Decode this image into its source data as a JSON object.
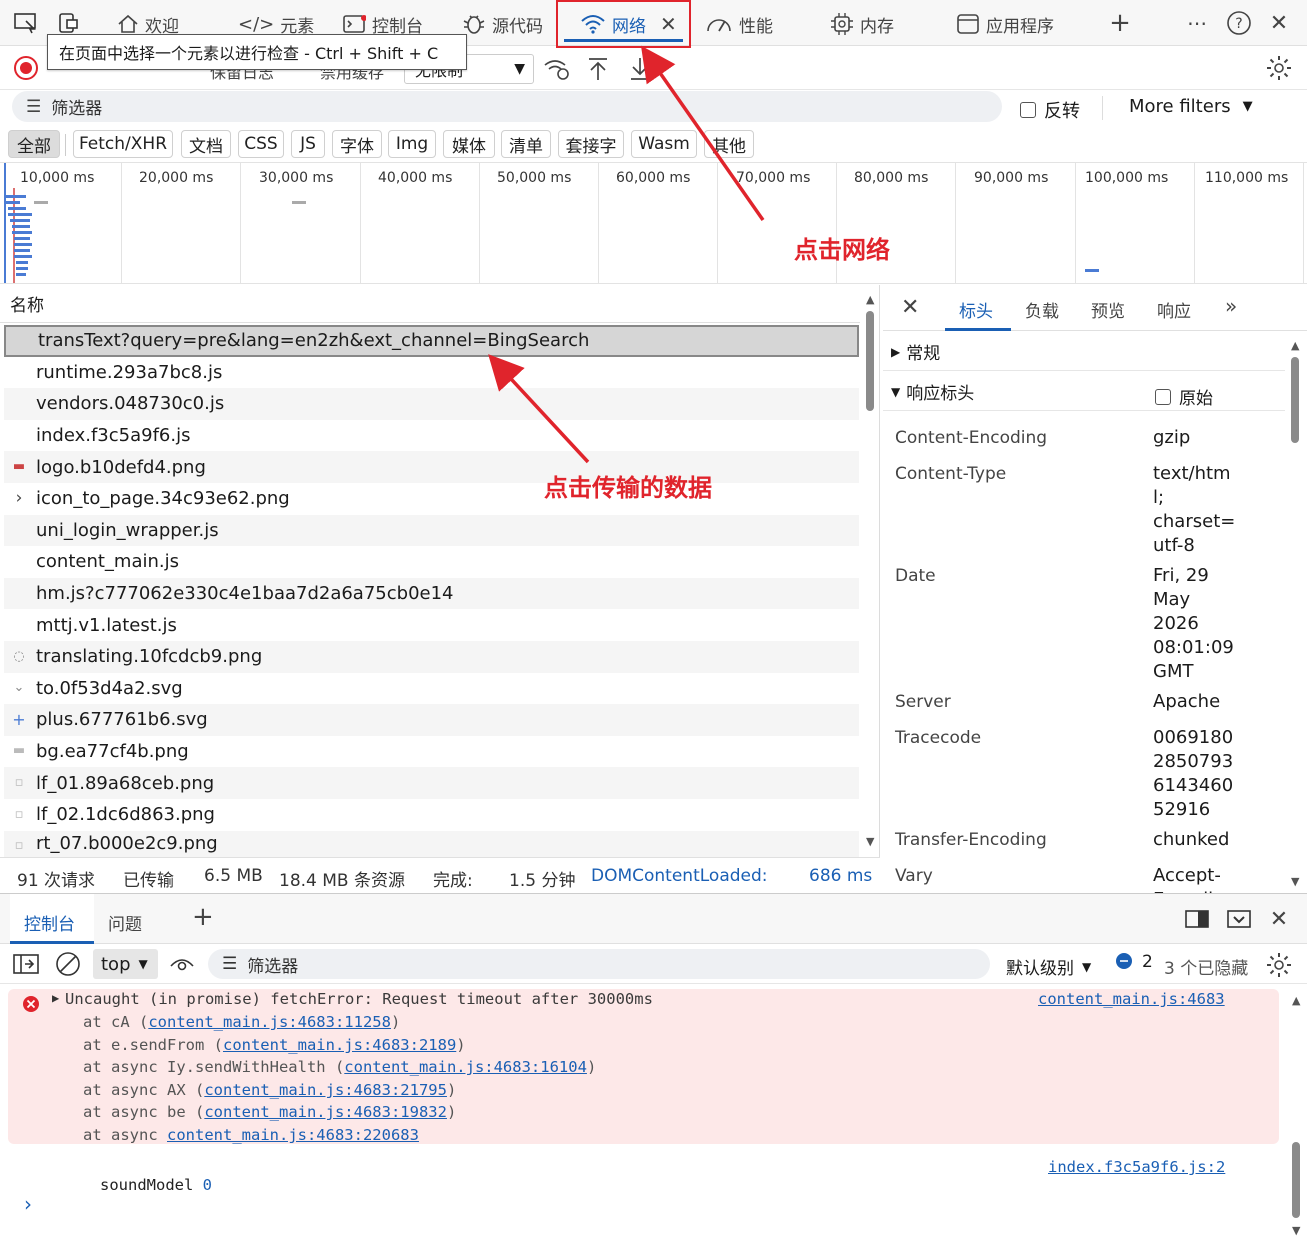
{
  "top_tabs": {
    "welcome": "欢迎",
    "elements": "元素",
    "console": "控制台",
    "sources": "源代码",
    "network": "网络",
    "performance": "性能",
    "memory": "内存",
    "application": "应用程序"
  },
  "tooltip": "在页面中选择一个元素以进行检查 - Ctrl + Shift + C",
  "toolbar": {
    "preserve_log": "保留日志",
    "disable_cache": "禁用缓存",
    "throttle": "无限制"
  },
  "filter": {
    "placeholder": "筛选器",
    "invert": "反转",
    "more_filters": "More filters"
  },
  "type_chips": [
    "全部",
    "Fetch/XHR",
    "文档",
    "CSS",
    "JS",
    "字体",
    "Img",
    "媒体",
    "清单",
    "套接字",
    "Wasm",
    "其他"
  ],
  "timeline_ticks": [
    "10,000 ms",
    "20,000 ms",
    "30,000 ms",
    "40,000 ms",
    "50,000 ms",
    "60,000 ms",
    "70,000 ms",
    "80,000 ms",
    "90,000 ms",
    "100,000 ms",
    "110,000 ms"
  ],
  "request_list": {
    "header": "名称",
    "rows": [
      "transText?query=pre&lang=en2zh&ext_channel=BingSearch",
      "runtime.293a7bc8.js",
      "vendors.048730c0.js",
      "index.f3c5a9f6.js",
      "logo.b10defd4.png",
      "icon_to_page.34c93e62.png",
      "uni_login_wrapper.js",
      "content_main.js",
      "hm.js?c777062e330c4e1baa7d2a6a75cb0e14",
      "mttj.v1.latest.js",
      "translating.10fcdcb9.png",
      "to.0f53d4a2.svg",
      "plus.677761b6.svg",
      "bg.ea77cf4b.png",
      "lf_01.89a68ceb.png",
      "lf_02.1dc6d863.png",
      "rt_07.b000e2c9.png"
    ]
  },
  "status_bar": {
    "requests": "91 次请求",
    "transferred_label": "已传输",
    "transferred": "6.5 MB",
    "resources": "18.4 MB 条资源",
    "finish_label": "完成:",
    "finish": "1.5 分钟",
    "dcl_label": "DOMContentLoaded:",
    "dcl": "686 ms"
  },
  "details": {
    "tabs": [
      "标头",
      "负载",
      "预览",
      "响应"
    ],
    "general": "常规",
    "response_headers": "响应标头",
    "raw": "原始",
    "headers": [
      {
        "key": "Content-Encoding",
        "value": "gzip"
      },
      {
        "key": "Content-Type",
        "value": "text/htm\nl;\ncharset=\nutf-8"
      },
      {
        "key": "Date",
        "value": "Fri, 29\nMay\n2026\n08:01:09\nGMT"
      },
      {
        "key": "Server",
        "value": "Apache"
      },
      {
        "key": "Tracecode",
        "value": "0069180\n2850793\n6143460\n52916"
      },
      {
        "key": "Transfer-Encoding",
        "value": "chunked"
      },
      {
        "key": "Vary",
        "value": "Accept-\nEncodin"
      }
    ]
  },
  "drawer": {
    "tabs": [
      "控制台",
      "问题"
    ],
    "context": "top",
    "filter_placeholder": "筛选器",
    "level": "默认级别",
    "msg_count": "2",
    "hidden": "3 个已隐藏"
  },
  "console": {
    "error_head": "Uncaught (in promise) fetchError: Request timeout after 30000ms",
    "error_source": "content_main.js:4683",
    "stack": [
      {
        "prefix": "at cA (",
        "link": "content_main.js:4683:11258",
        "suffix": ")"
      },
      {
        "prefix": "at e.sendFrom (",
        "link": "content_main.js:4683:2189",
        "suffix": ")"
      },
      {
        "prefix": "at async Iy.sendWithHealth (",
        "link": "content_main.js:4683:16104",
        "suffix": ")"
      },
      {
        "prefix": "at async AX (",
        "link": "content_main.js:4683:21795",
        "suffix": ")"
      },
      {
        "prefix": "at async be (",
        "link": "content_main.js:4683:19832",
        "suffix": ")"
      },
      {
        "prefix": "at async ",
        "link": "content_main.js:4683:220683",
        "suffix": ""
      }
    ],
    "log_text": "soundModel",
    "log_value": "0",
    "log_source": "index.f3c5a9f6.js:2"
  },
  "annotations": {
    "click_network": "点击网络",
    "click_data": "点击传输的数据"
  },
  "colors": {
    "accent": "#1a5fb4",
    "annotation_red": "#e0242c",
    "error_bg": "#fde8e8"
  }
}
